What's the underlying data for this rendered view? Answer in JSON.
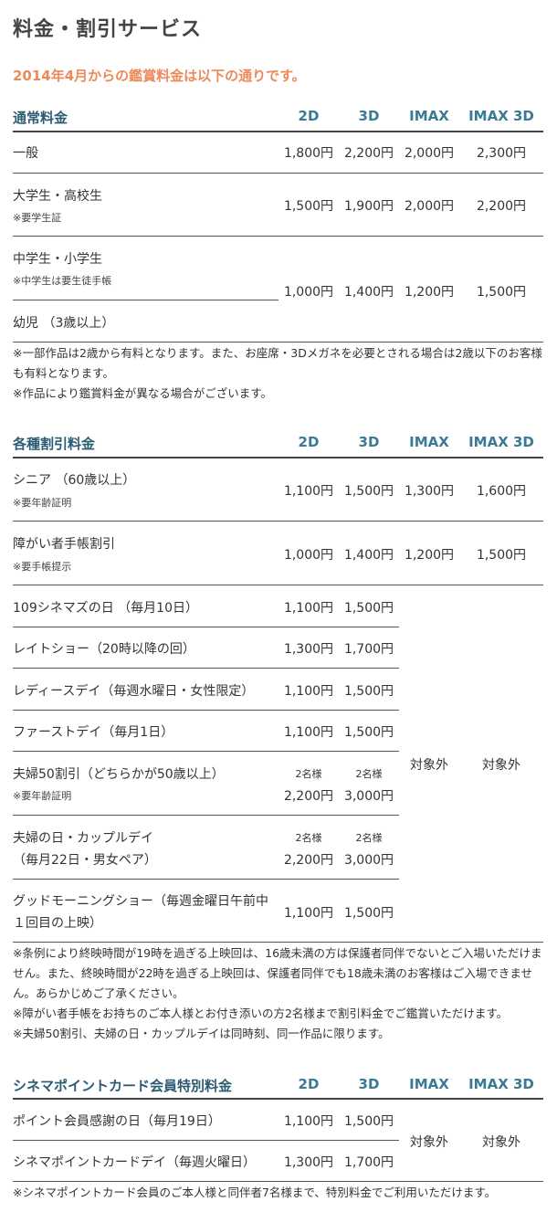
{
  "page_title": "料金・割引サービス",
  "subtitle": "2014年4月からの鑑賞料金は以下の通りです。",
  "columns": [
    "2D",
    "3D",
    "IMAX",
    "IMAX 3D"
  ],
  "regular": {
    "title": "通常料金",
    "rows": [
      {
        "label": "一般",
        "note": "",
        "prices": [
          "1,800円",
          "2,200円",
          "2,000円",
          "2,300円"
        ]
      },
      {
        "label": "大学生・高校生",
        "note": "※要学生証",
        "prices": [
          "1,500円",
          "1,900円",
          "2,000円",
          "2,200円"
        ]
      },
      {
        "label": "中学生・小学生",
        "note": "※中学生は要生徒手帳",
        "prices": [
          "1,000円",
          "1,400円",
          "1,200円",
          "1,500円"
        ]
      },
      {
        "label": "幼児 （3歳以上）",
        "note": "",
        "prices": []
      }
    ],
    "notes": [
      "※一部作品は2歳から有料となります。また、お座席・3Dメガネを必要とされる場合は2歳以下のお客様も有料となります。",
      "※作品により鑑賞料金が異なる場合がございます。"
    ]
  },
  "discount": {
    "title": "各種割引料金",
    "rows": [
      {
        "label": "シニア （60歳以上）",
        "note": "※要年齢証明",
        "prices": [
          "1,100円",
          "1,500円",
          "1,300円",
          "1,600円"
        ]
      },
      {
        "label": "障がい者手帳割引",
        "note": "※要手帳提示",
        "prices": [
          "1,000円",
          "1,400円",
          "1,200円",
          "1,500円"
        ]
      },
      {
        "label": "109シネマズの日 （毎月10日）",
        "note": "",
        "prices": [
          "1,100円",
          "1,500円"
        ]
      },
      {
        "label": "レイトショー（20時以降の回）",
        "note": "",
        "prices": [
          "1,300円",
          "1,700円"
        ]
      },
      {
        "label": "レディースデイ（毎週水曜日・女性限定）",
        "note": "",
        "prices": [
          "1,100円",
          "1,500円"
        ]
      },
      {
        "label": "ファーストデイ（毎月1日）",
        "note": "",
        "prices": [
          "1,100円",
          "1,500円"
        ]
      },
      {
        "label": "夫婦50割引（どちらかが50歳以上）",
        "note": "※要年齢証明",
        "qty": "2名様",
        "prices": [
          "2,200円",
          "3,000円"
        ]
      },
      {
        "label": "夫婦の日・カップルデイ",
        "label2": "（毎月22日・男女ペア）",
        "qty": "2名様",
        "prices": [
          "2,200円",
          "3,000円"
        ]
      },
      {
        "label": "グッドモーニングショー（毎週金曜日午前中",
        "label2": "１回目の上映）",
        "prices": [
          "1,100円",
          "1,500円"
        ]
      }
    ],
    "excluded": "対象外",
    "notes": [
      "※条例により終映時間が19時を過ぎる上映回は、16歳未満の方は保護者同伴でないとご入場いただけません。また、終映時間が22時を過ぎる上映回は、保護者同伴でも18歳未満のお客様はご入場できません。あらかじめご了承ください。",
      "※障がい者手帳をお持ちのご本人様とお付き添いの方2名様まで割引料金でご鑑賞いただけます。",
      "※夫婦50割引、夫婦の日・カップルデイは同時刻、同一作品に限ります。"
    ]
  },
  "cinemapoint": {
    "title": "シネマポイントカード会員特別料金",
    "rows": [
      {
        "label": "ポイント会員感謝の日（毎月19日）",
        "prices": [
          "1,100円",
          "1,500円"
        ]
      },
      {
        "label": "シネマポイントカードデイ（毎週火曜日）",
        "prices": [
          "1,300円",
          "1,700円"
        ]
      }
    ],
    "excluded": "対象外",
    "notes": [
      "※シネマポイントカード会員のご本人様と同伴者7名様まで、特別料金でご利用いただけます。"
    ]
  }
}
